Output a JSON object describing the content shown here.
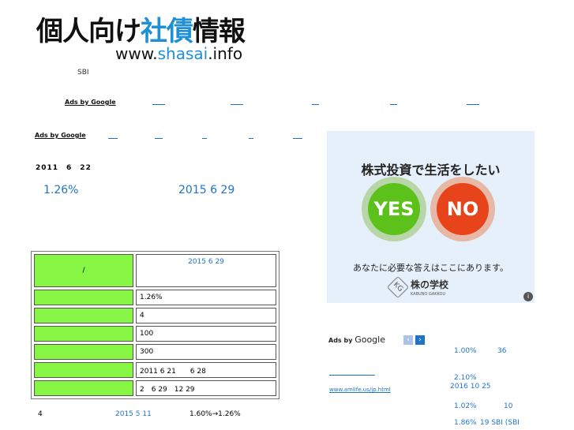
{
  "header": {
    "title_part1": "個人向け",
    "title_part2": "社債",
    "title_part3": "情報",
    "url_prefix": "www.",
    "url_mid": "shasai",
    "url_suffix": ".info"
  },
  "top_note": "SBI",
  "ads1_label": "Ads by Google",
  "ads2_label": "Ads by Google",
  "date_line": "2011　6　22",
  "rate_summary": "1.26%",
  "maturity_summary": "2015 6 29",
  "table": {
    "header_label": "/",
    "header_value": "2015 6 29",
    "rows": [
      {
        "value": "1.26%"
      },
      {
        "value": "4"
      },
      {
        "value": "100"
      },
      {
        "value": "300"
      },
      {
        "value": "2011 6 21　　6 28"
      },
      {
        "value": "2　6 29　12 29"
      }
    ]
  },
  "footer_line": {
    "count": "4",
    "date": "2015 5 11",
    "rate_change": "1.60%→1.26%"
  },
  "banner": {
    "headline": "株式投資で生活をしたい",
    "yes_label": "YES",
    "no_label": "NO",
    "subtext": "あなたに必要な答えはここにあります。",
    "school_name": "株の学校",
    "school_sub": "KABUNO GAKKOU",
    "info_glyph": "i"
  },
  "right_ads": {
    "label_prefix": "Ads by",
    "label_google": "Google",
    "prev_glyph": "‹",
    "next_glyph": "›",
    "link_url": "www.amlife.us/jp.html",
    "items": [
      {
        "rate": "1.00%",
        "num": "36"
      },
      {
        "rate": "2.10%",
        "num": "2016 10 25"
      },
      {
        "rate": "1.02%",
        "num": "10"
      },
      {
        "rate": "1.86%",
        "num": "19  SBI (SBI"
      }
    ]
  },
  "colors": {
    "brand_blue": "#1f8fd6",
    "label_green": "#86f543",
    "yes_green": "#5cc21b",
    "no_red": "#e8441c"
  }
}
